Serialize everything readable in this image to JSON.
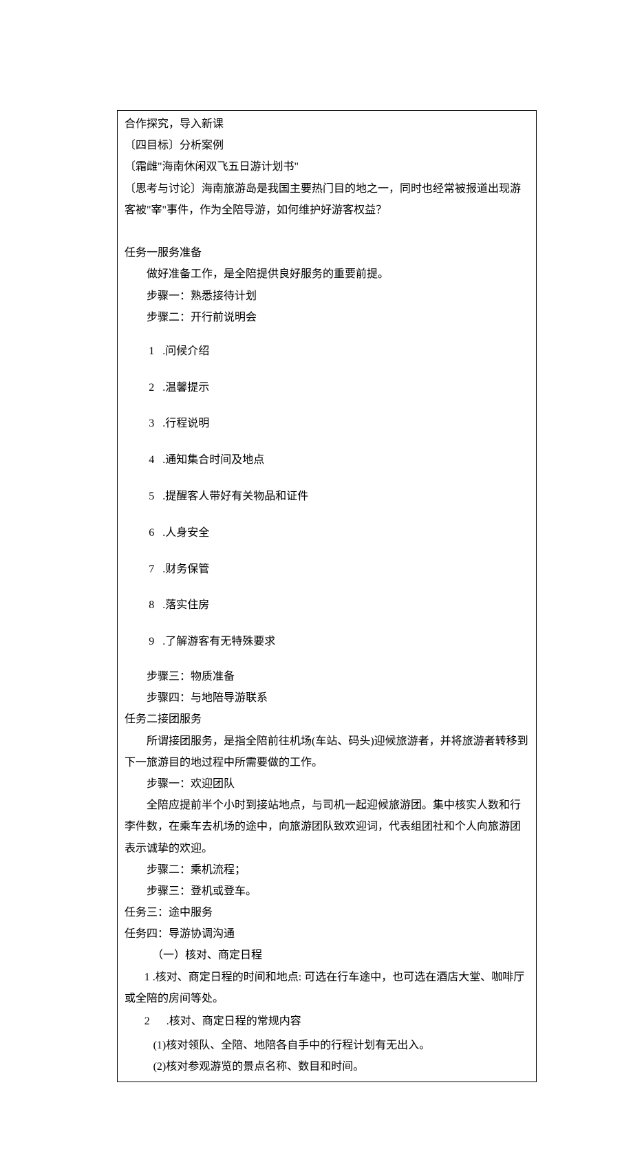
{
  "intro": {
    "line1": "合作探究，导入新课",
    "line2": "〔四目标〕分析案例",
    "line3": "〔霜雌\"海南休闲双飞五日游计划书\"",
    "line4": "〔思考与讨论〕海南旅游岛是我国主要热门目的地之一，同时也经常被报道出现游客被\"宰\"事件，作为全陪导游，如何维护好游客权益？"
  },
  "task1": {
    "title": "任务一服务准备",
    "desc": "做好准备工作，是全陪提供良好服务的重要前提。",
    "step1": "步骤一：熟悉接待计划",
    "step2": "步骤二：开行前说明会",
    "items": [
      ".问候介绍",
      ".温馨提示",
      ".行程说明",
      ".通知集合时间及地点",
      ".提醒客人带好有关物品和证件",
      ".人身安全",
      ".财务保管",
      ".落实住房",
      ".了解游客有无特殊要求"
    ],
    "step3": "步骤三：物质准备",
    "step4": "步骤四：与地陪导游联系"
  },
  "task2": {
    "title": "任务二接团服务",
    "desc": "所谓接团服务，是指全陪前往机场(车站、码头)迎候旅游者，并将旅游者转移到下一旅游目的地过程中所需要做的工作。",
    "step1": "步骤一：欢迎团队",
    "step1desc": "全陪应提前半个小时到接站地点，与司机一起迎候旅游团。集中核实人数和行李件数，在乘车去机场的途中，向旅游团队致欢迎词，代表组团社和个人向旅游团表示诚挚的欢迎。",
    "step2": "步骤二：乘机流程；",
    "step3": "步骤三：登机或登车。"
  },
  "task3": {
    "title": "任务三：途中服务"
  },
  "task4": {
    "title": "任务四：导游协调沟通",
    "sub1": "（一）核对、商定日程",
    "item1": "1  .核对、商定日程的时间和地点: 可选在行车途中，也可选在酒店大堂、咖啡厅或全陪的房间等处。",
    "item2num": "2",
    "item2text": ".核对、商定日程的常规内容",
    "sub_a": "(1)核对领队、全陪、地陪各自手中的行程计划有无出入。",
    "sub_b": "(2)核对参观游览的景点名称、数目和时间。"
  }
}
